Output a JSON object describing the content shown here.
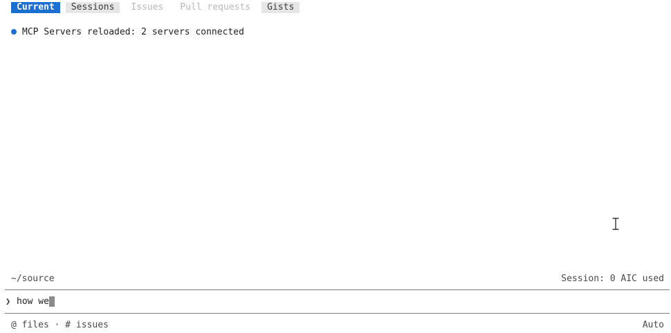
{
  "tabs": [
    {
      "label": "Current",
      "state": "active"
    },
    {
      "label": "Sessions",
      "state": "enabled"
    },
    {
      "label": "Issues",
      "state": "disabled"
    },
    {
      "label": "Pull requests",
      "state": "disabled"
    },
    {
      "label": "Gists",
      "state": "enabled"
    }
  ],
  "status": {
    "message": "MCP Servers reloaded: 2 servers connected",
    "indicator_color": "#1a6fd1"
  },
  "footer": {
    "cwd": "~/source",
    "session_usage": "Session: 0 AIC used"
  },
  "prompt": {
    "glyph": "❯",
    "value": "how we"
  },
  "hints": {
    "files": "@ files",
    "separator": " · ",
    "issues": "# issues",
    "mode": "Auto"
  },
  "colors": {
    "accent": "#1a6fd1",
    "tab_enabled_bg": "#e6e6e6",
    "tab_disabled_text": "#b8b8b8"
  }
}
